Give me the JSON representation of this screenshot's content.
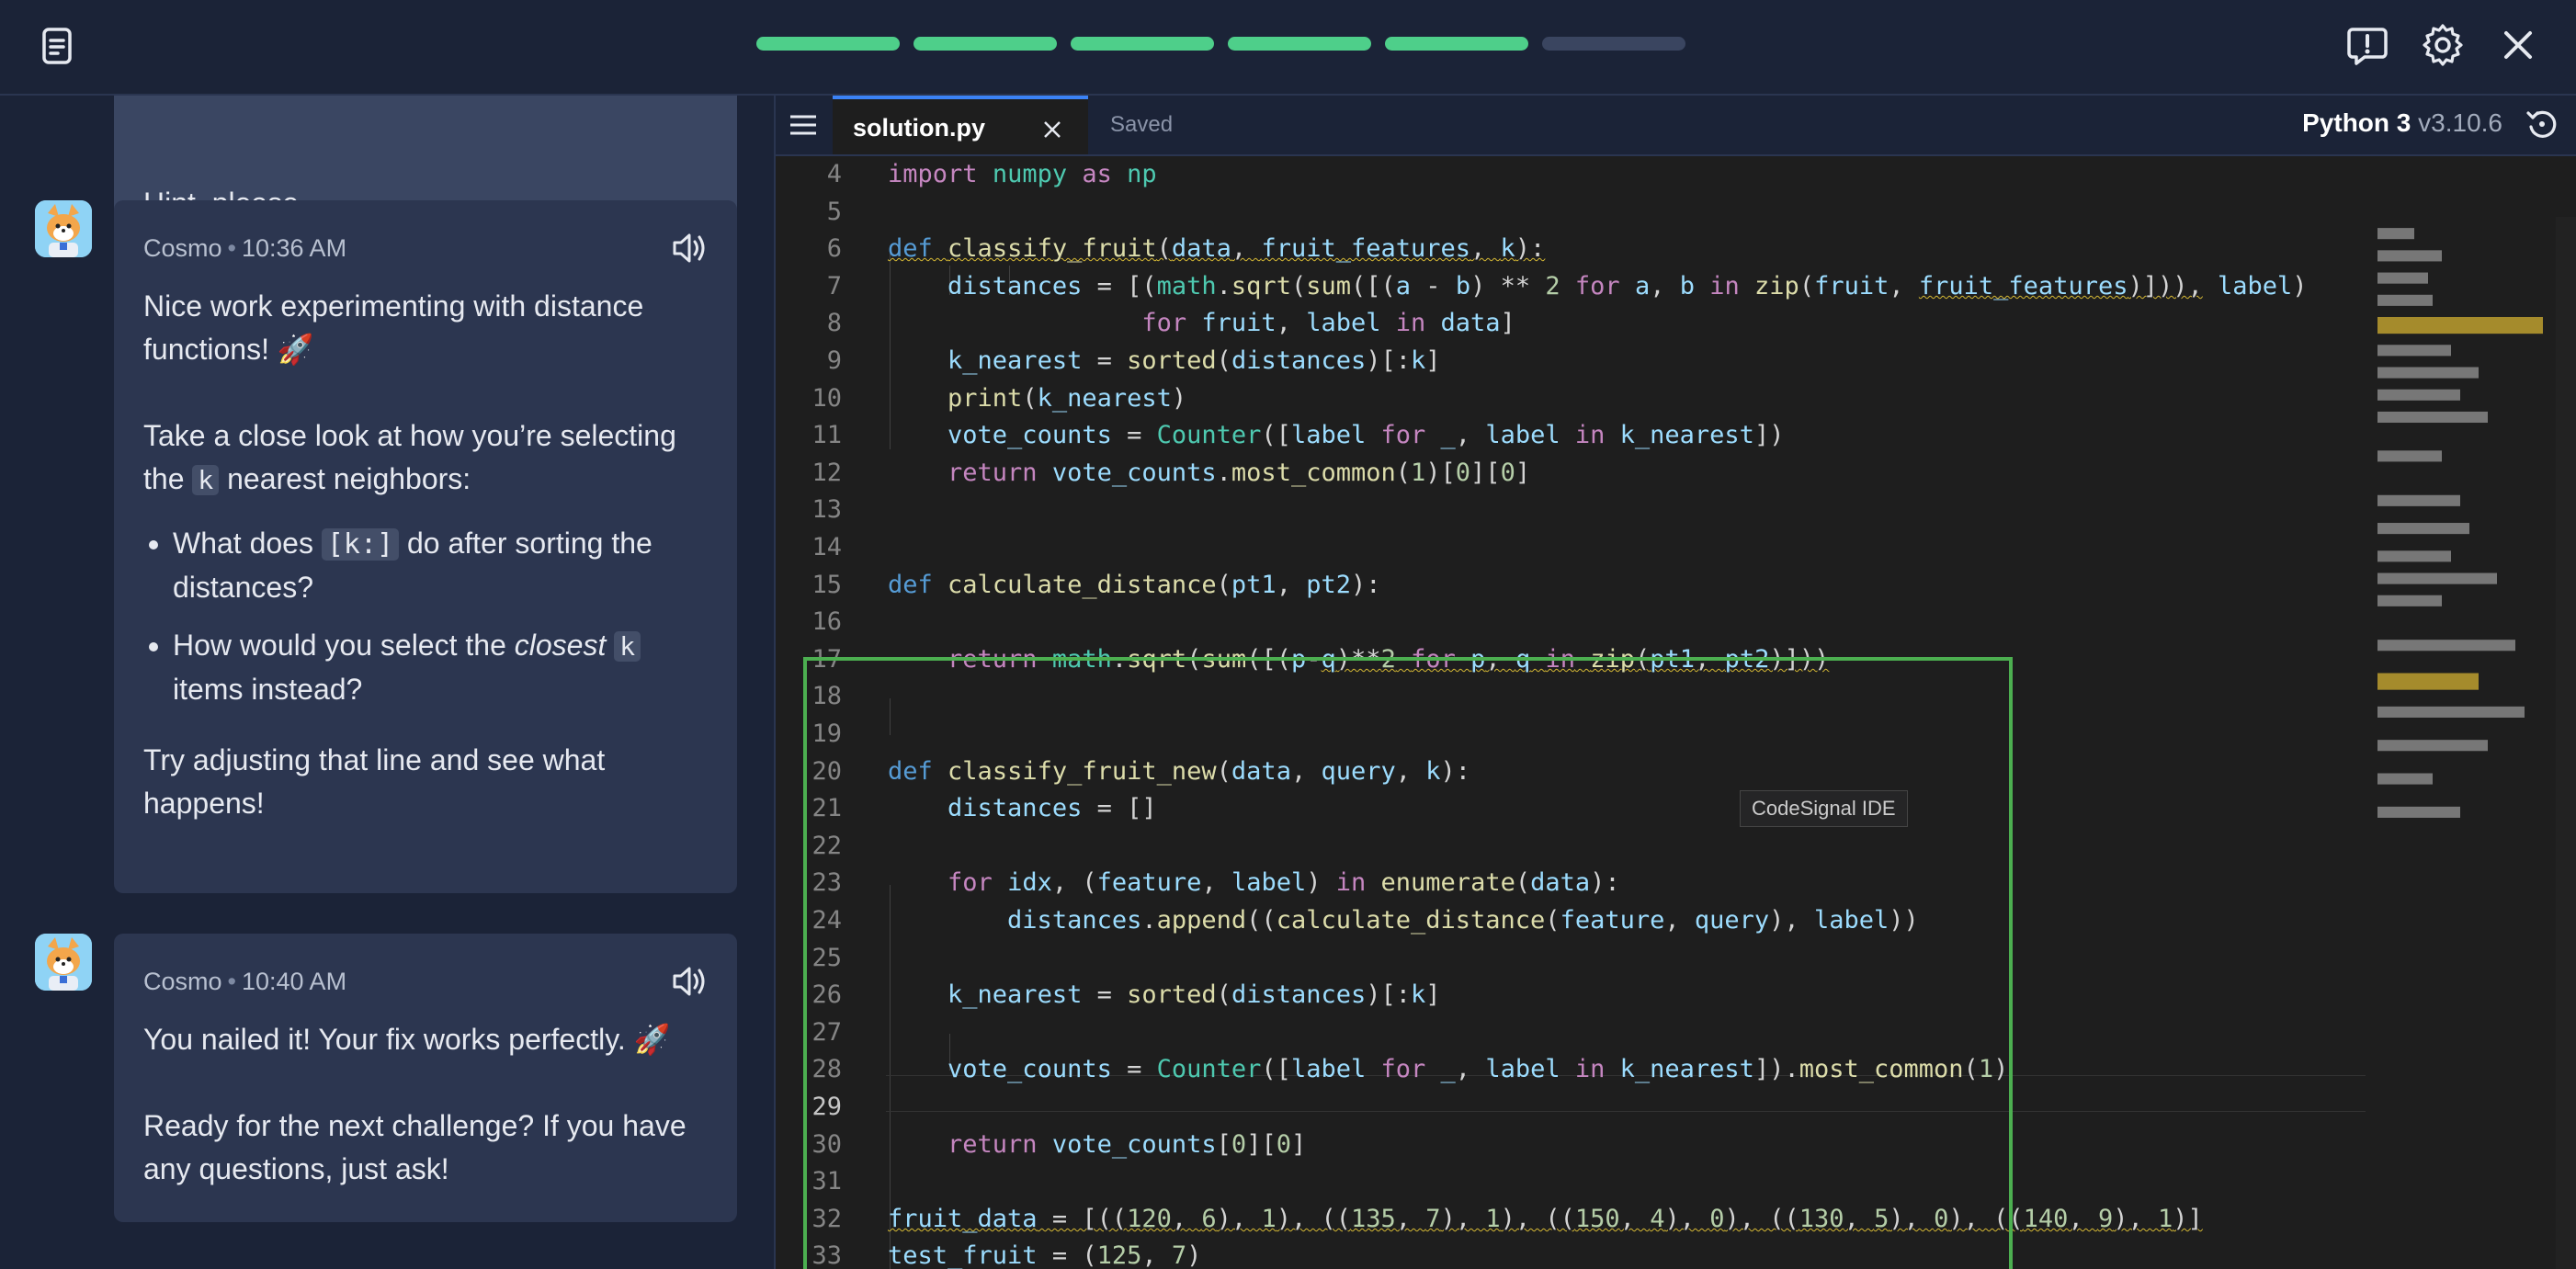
{
  "topbar": {
    "progress": [
      true,
      true,
      true,
      true,
      true,
      false
    ]
  },
  "chat": {
    "user_message": "Hint, please",
    "messages": [
      {
        "author": "Cosmo",
        "time": "10:36 AM",
        "p1": "Nice work experimenting with distance functions! 🚀",
        "p2_before": "Take a close look at how you’re selecting the",
        "p2_code": "k",
        "p2_after": "nearest neighbors:",
        "b1_before": "What does",
        "b1_code": "[k:]",
        "b1_after": "do after sorting the distances?",
        "b2_before": "How would you select the",
        "b2_em": "closest",
        "b2_code": "k",
        "b2_after": "items instead?",
        "p3": "Try adjusting that line and see what happens!"
      },
      {
        "author": "Cosmo",
        "time": "10:40 AM",
        "p1": "You nailed it! Your fix works perfectly. 🚀",
        "p2": "Ready for the next challenge? If you have any questions, just ask!"
      }
    ]
  },
  "editor": {
    "tab_name": "solution.py",
    "status": "Saved",
    "language": "Python 3",
    "version": "v3.10.6",
    "tooltip": "CodeSignal IDE",
    "line_numbers": [
      "4",
      "5",
      "6",
      "7",
      "8",
      "9",
      "10",
      "11",
      "12",
      "13",
      "14",
      "15",
      "16",
      "17",
      "18",
      "19",
      "20",
      "21",
      "22",
      "23",
      "24",
      "25",
      "26",
      "27",
      "28",
      "29",
      "30",
      "31",
      "32",
      "33"
    ]
  },
  "colors": {
    "accent_green": "#4caf50",
    "progress_done": "#4ecf8a",
    "tab_accent": "#3b82f6"
  }
}
